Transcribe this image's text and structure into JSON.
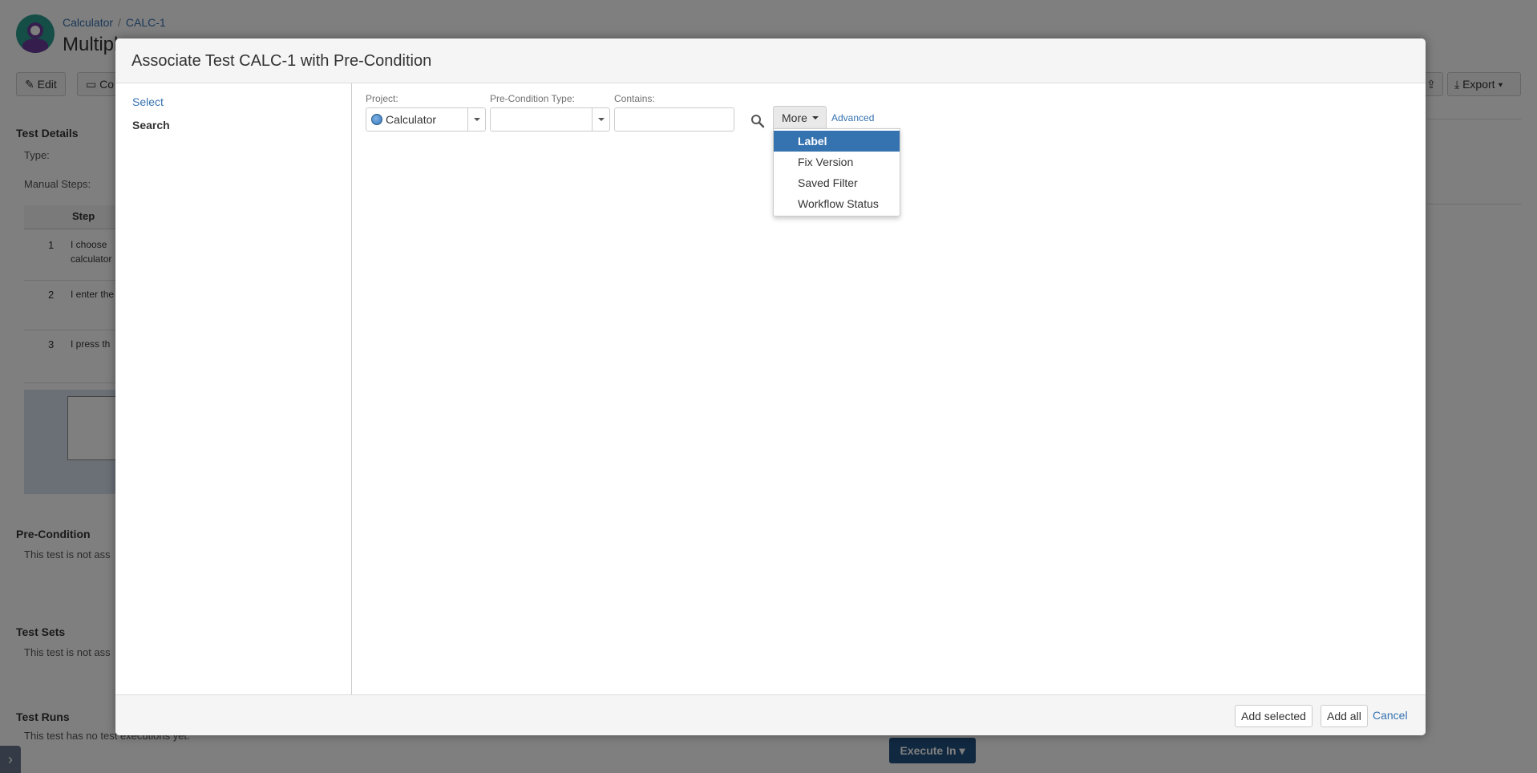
{
  "background": {
    "breadcrumb": {
      "project": "Calculator",
      "separator": "/",
      "issue": "CALC-1"
    },
    "page_title": "Multipl",
    "toolbar": {
      "edit": "Edit",
      "comment": "Co",
      "export": "Export"
    },
    "sections": {
      "test_details": "Test Details",
      "type_label": "Type:",
      "manual_steps_label": "Manual Steps:",
      "step_column": "Step",
      "steps": [
        {
          "num": "1",
          "text_line1": "I choose",
          "text_line2": "calculator"
        },
        {
          "num": "2",
          "text_line1": "I enter the",
          "text_line2": ""
        },
        {
          "num": "3",
          "text_line1": "I press th",
          "text_line2": ""
        }
      ],
      "pre_condition": "Pre-Condition",
      "pre_condition_text": "This test is not ass",
      "test_sets": "Test Sets",
      "test_sets_text": "This test is not ass",
      "test_runs": "Test Runs",
      "test_runs_text": "This test has no test executions yet."
    },
    "execute_button": "Execute In"
  },
  "dialog": {
    "title": "Associate Test CALC-1 with Pre-Condition",
    "nav": {
      "select": "Select",
      "search": "Search"
    },
    "filters": {
      "project_label": "Project:",
      "project_value": "Calculator",
      "precondition_type_label": "Pre-Condition Type:",
      "precondition_type_value": "",
      "contains_label": "Contains:",
      "contains_value": ""
    },
    "more_button": "More",
    "advanced_link": "Advanced",
    "more_menu": [
      "Label",
      "Fix Version",
      "Saved Filter",
      "Workflow Status"
    ],
    "footer": {
      "add_selected": "Add selected",
      "add_all": "Add all",
      "cancel": "Cancel"
    }
  },
  "colors": {
    "accent": "#3572b0",
    "execute": "#205081",
    "overlay": "rgba(0,0,0,0.5)"
  }
}
